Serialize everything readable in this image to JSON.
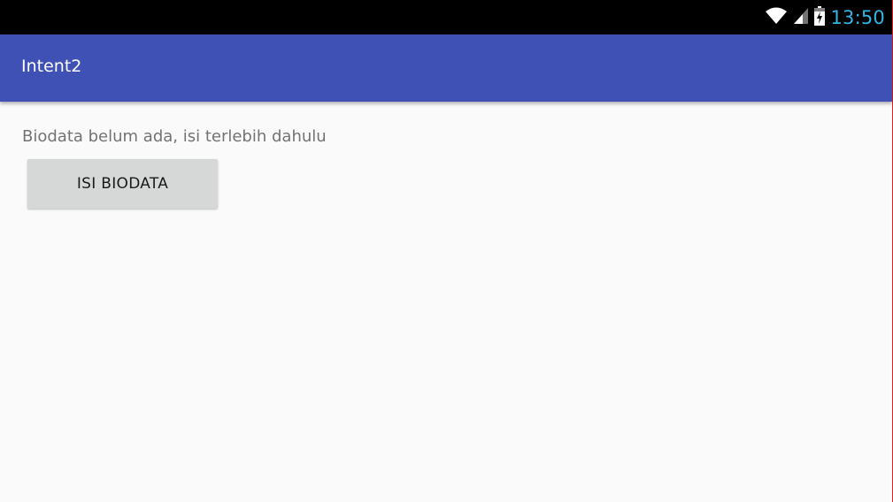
{
  "status_bar": {
    "time": "13:50",
    "icons": [
      "wifi-icon",
      "signal-icon",
      "battery-charging-icon"
    ],
    "time_color": "#33b5e5"
  },
  "app_bar": {
    "title": "Intent2",
    "color": "#3f51b5"
  },
  "main": {
    "message": "Biodata belum ada, isi terlebih dahulu",
    "button_label": "ISI BIODATA"
  }
}
